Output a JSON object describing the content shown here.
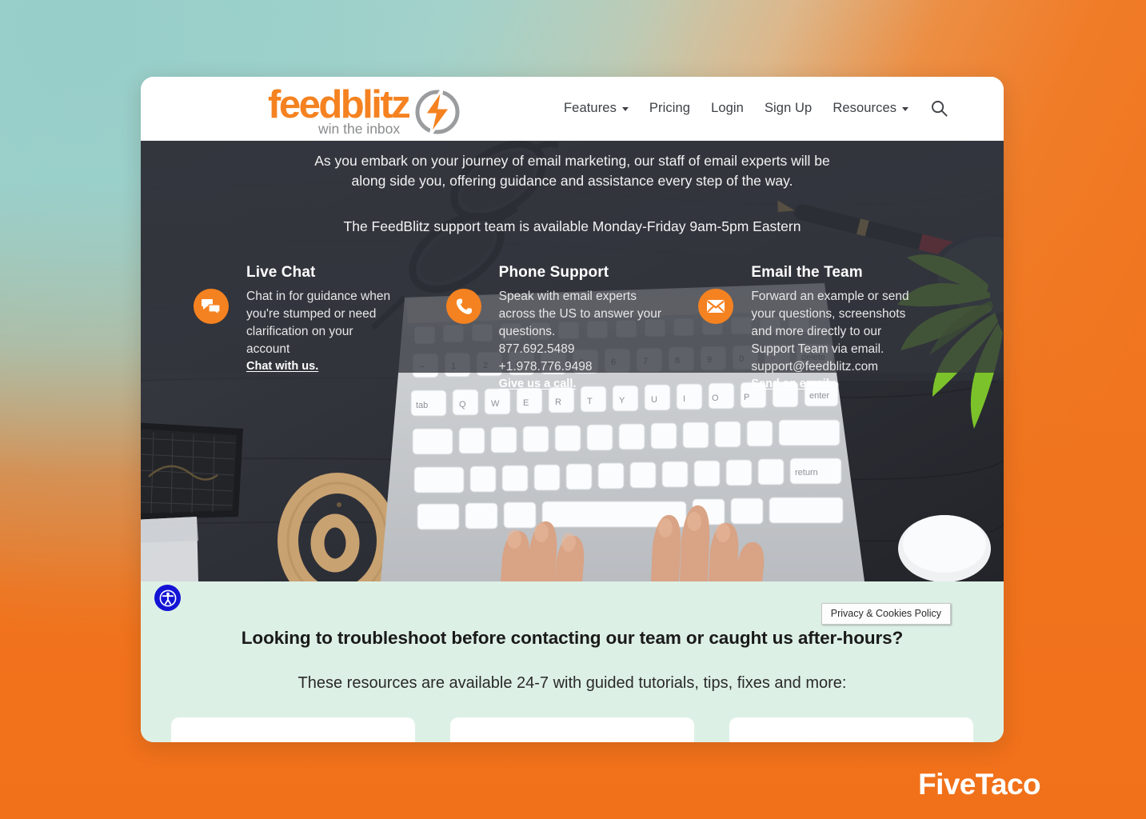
{
  "header": {
    "logo": {
      "wordmark": "feedblitz",
      "tagline": "win the inbox",
      "icon": "lightning-bolt-icon"
    },
    "nav": [
      {
        "label": "Features",
        "has_dropdown": true
      },
      {
        "label": "Pricing",
        "has_dropdown": false
      },
      {
        "label": "Login",
        "has_dropdown": false
      },
      {
        "label": "Sign Up",
        "has_dropdown": false
      },
      {
        "label": "Resources",
        "has_dropdown": true
      }
    ],
    "search_icon": "search-icon"
  },
  "hero": {
    "lead_line1": "As you embark on your journey of email marketing, our staff of email experts will be",
    "lead_line2": "along side you, offering guidance and assistance every step of the way.",
    "hours": "The FeedBlitz support team is available Monday-Friday 9am-5pm Eastern",
    "columns": [
      {
        "icon": "chat-bubbles-icon",
        "title": "Live Chat",
        "lines": [
          "Chat in for guidance when",
          "you're stumped or need",
          "clarification on your",
          "account"
        ],
        "link": "Chat with us."
      },
      {
        "icon": "phone-icon",
        "title": "Phone Support",
        "lines": [
          "Speak with email experts",
          "across the US to answer your",
          "questions.",
          "877.692.5489",
          "+1.978.776.9498"
        ],
        "link": "Give us a call."
      },
      {
        "icon": "envelope-icon",
        "title": "Email the Team",
        "lines": [
          "Forward an example or send",
          "your questions, screenshots",
          "and more directly to our",
          "Support Team via email.",
          "support@feedblitz.com"
        ],
        "link": "Send an email."
      }
    ]
  },
  "resources": {
    "heading": "Looking to troubleshoot before contacting our team or caught us after-hours?",
    "subheading": "These resources are available 24-7 with guided tutorials, tips, fixes and more:",
    "cards": [
      {
        "icon": "book-icon"
      },
      {
        "icon": "folder-icon"
      },
      {
        "icon": "drop-icon"
      }
    ]
  },
  "overlays": {
    "accessibility_button_label": "Accessibility",
    "accessibility_icon": "accessibility-person-icon",
    "privacy_chip": "Privacy & Cookies Policy"
  },
  "watermark": {
    "text": "FiveTaco"
  },
  "colors": {
    "brand_orange": "#f58220",
    "header_bg": "#ffffff",
    "hero_bg": "#34363f",
    "resources_bg": "#ddf0e6",
    "a11y_blue": "#1313d6",
    "backdrop_teal": "#9fd3cd",
    "backdrop_orange": "#f2751f"
  }
}
